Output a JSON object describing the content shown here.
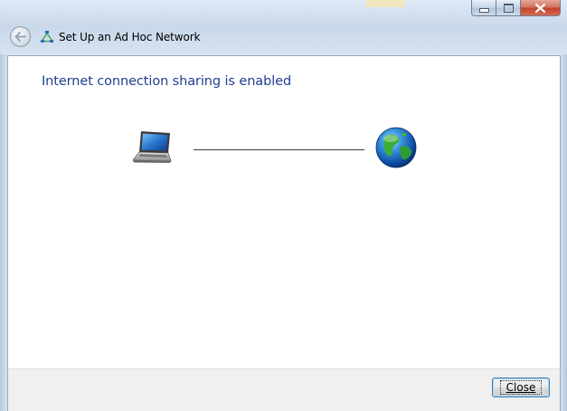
{
  "window": {
    "title": "Set Up an Ad Hoc Network",
    "caption_buttons": [
      "minimize",
      "maximize",
      "close"
    ]
  },
  "content": {
    "heading": "Internet connection sharing is enabled",
    "diagram": {
      "left_icon": "laptop-icon",
      "right_icon": "globe-icon"
    }
  },
  "footer": {
    "close_label": "Close"
  },
  "colors": {
    "heading": "#1e3f8f",
    "close_caption": "#c2402a",
    "default_button_border": "#3c7fb1"
  }
}
